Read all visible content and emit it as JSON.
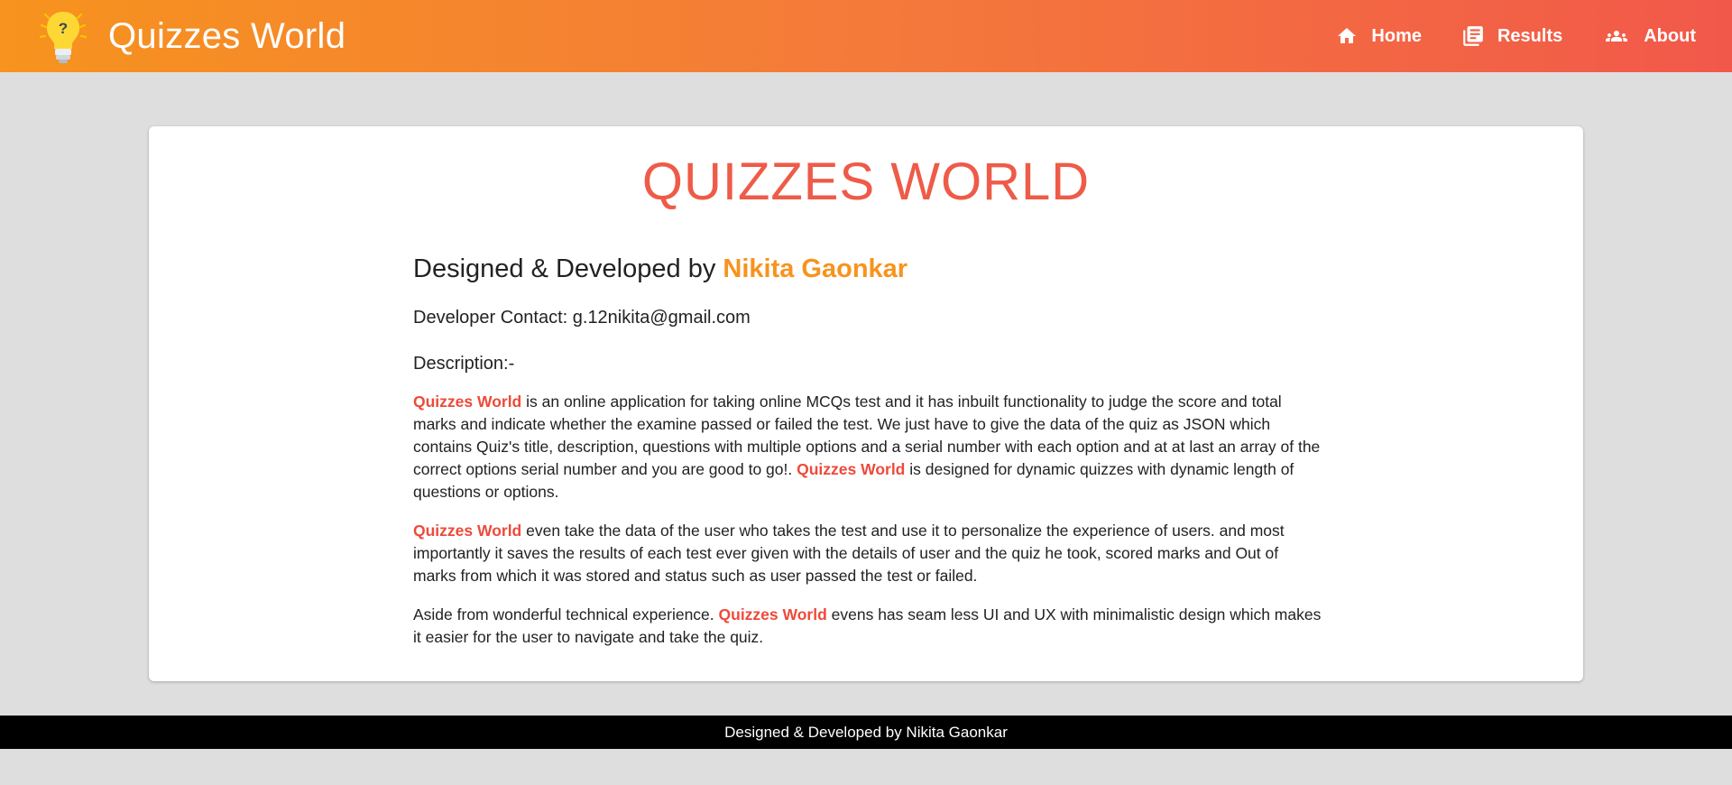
{
  "header": {
    "brand_title": "Quizzes World",
    "logo_icon": "lightbulb-question-icon",
    "nav": [
      {
        "label": "Home",
        "icon": "home-icon"
      },
      {
        "label": "Results",
        "icon": "newspaper-icon"
      },
      {
        "label": "About",
        "icon": "people-icon"
      }
    ]
  },
  "about": {
    "title": "QUIZZES WORLD",
    "designed_prefix": "Designed & Developed by",
    "designed_name": "Nikita Gaonkar",
    "contact": "Developer Contact: g.12nikita@gmail.com",
    "description_heading": "Description:-",
    "brand_highlight": "Quizzes World",
    "p1_a": " is an online application for taking online MCQs test and it has inbuilt functionality to judge the score and total marks and indicate whether the examine passed or failed the test. We just have to give the data of the quiz as JSON which contains Quiz's title, description, questions with multiple options and a serial number with each option and at at last an array of the correct options serial number and you are good to go!. ",
    "p1_b": " is designed for dynamic quizzes with dynamic length of questions or options.",
    "p2": " even take the data of the user who takes the test and use it to personalize the experience of users. and most importantly it saves the results of each test ever given with the details of user and the quiz he took, scored marks and Out of marks from which it was stored and status such as user passed the test or failed.",
    "p3_a": "Aside from wonderful technical experience. ",
    "p3_b": " evens has seam less UI and UX with minimalistic design which makes it easier for the user to navigate and take the quiz."
  },
  "footer": {
    "text": "Designed & Developed by Nikita Gaonkar"
  },
  "colors": {
    "header_gradient_start": "#f7931e",
    "header_gradient_end": "#f2584a",
    "title_red": "#ee5b48",
    "name_orange": "#f7931e",
    "highlight_red": "#ee4a3a"
  }
}
